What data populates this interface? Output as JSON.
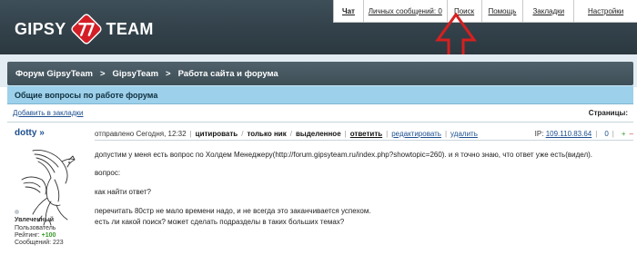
{
  "header": {
    "logo_left": "GIPSY",
    "logo_right": "TEAM",
    "nav": [
      {
        "label": "Чат",
        "name": "nav-chat"
      },
      {
        "label": "Личных сообщений: 0",
        "name": "nav-private-messages"
      },
      {
        "label": "Поиск",
        "name": "nav-search"
      },
      {
        "label": "Помощь",
        "name": "nav-help"
      },
      {
        "label": "Закладки",
        "name": "nav-bookmarks"
      },
      {
        "label": "Настройки",
        "name": "nav-settings"
      }
    ]
  },
  "breadcrumb": {
    "items": [
      "Форум GipsyTeam",
      "GipsyTeam",
      "Работа сайта и форума"
    ],
    "separator": ">"
  },
  "subforum_title": "Общие вопросы по работе форума",
  "toolbar": {
    "bookmark_link": "Добавить в закладки",
    "pages_label": "Страницы:"
  },
  "post": {
    "author": "dotty »",
    "rank": "Увлеченный",
    "role": "Пользователь",
    "rating_label": "Рейтинг:",
    "rating_value": "+100",
    "posts_label": "Сообщений: 223",
    "sent": "отправлено Сегодня, 12:32",
    "actions": {
      "quote": "цитировать",
      "nick_only": "только ник",
      "selected": "выделенное",
      "reply": "ответить",
      "edit": "редактировать",
      "delete": "удалить"
    },
    "ip_label": "IP:",
    "ip_value": "109.110.83.64",
    "ctrl_zero": "0",
    "ctrl_plus": "+",
    "ctrl_minus": "–",
    "body": [
      "допустим у меня есть вопрос по Холдем Менеджеру(http://forum.gipsyteam.ru/index.php?showtopic=260). и я точно знаю, что ответ уже есть(видел).",
      "вопрос:",
      "как найти ответ?",
      "перечитать 80стр не мало времени надо, и не всегда это заканчивается успехом.",
      "есть ли какой поиск? может сделать подразделы в таких больших темах?"
    ]
  },
  "colors": {
    "header_bg": "#34434c",
    "title_band": "#9dd0ea",
    "link": "#1d4f8f",
    "annotation_arrow": "#d62020",
    "logo_accent": "#d41e26"
  }
}
